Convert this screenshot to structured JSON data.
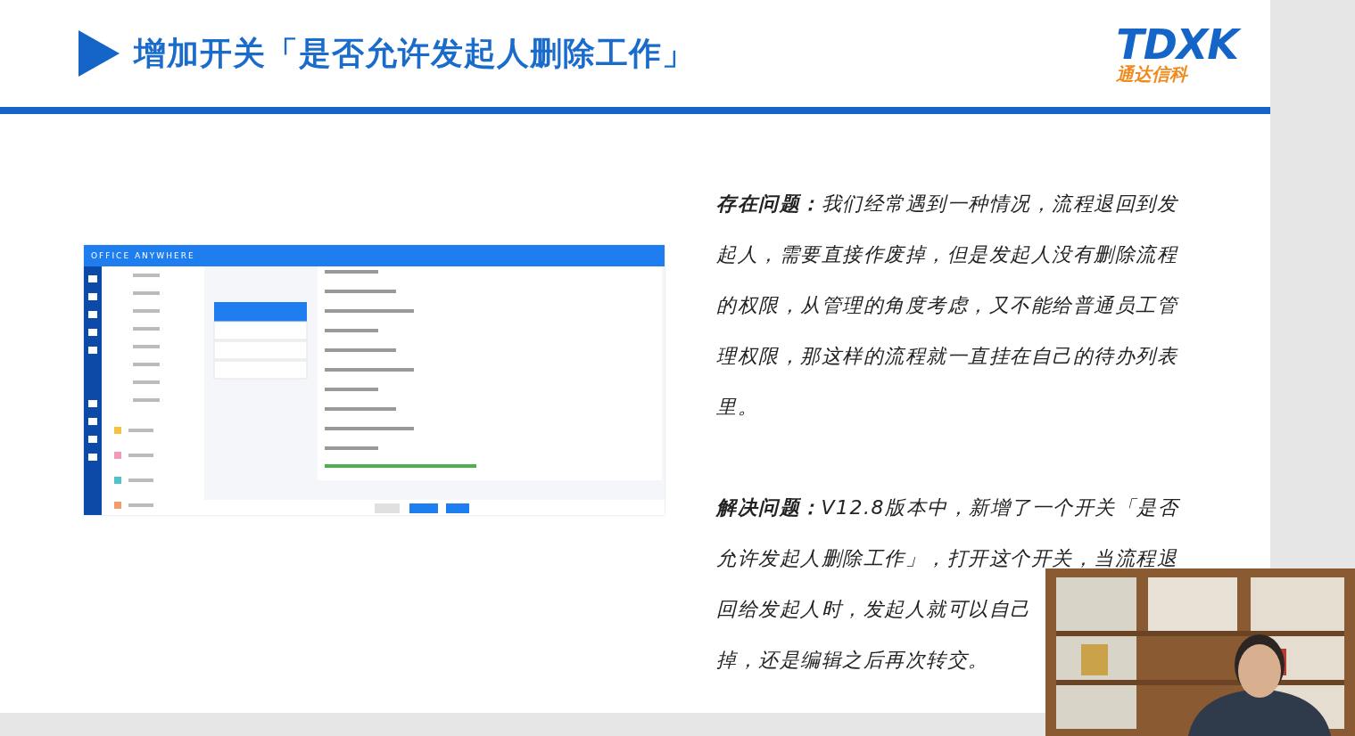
{
  "slide": {
    "title": "增加开关「是否允许发起人删除工作」",
    "logo": {
      "mark": "TDXK",
      "name": "通达信科"
    },
    "screenshot": {
      "kind": "app",
      "brand": "OFFICE ANYWHERE"
    },
    "paragraphs": [
      {
        "lines": [
          "**存在问题：**我们经常遇到一种情况，流程退回到发",
          "起人，需要直接作废掉，但是发起人没有删除流程",
          "的权限，从管理的角度考虑，又不能给普通员工管",
          "理权限，那这样的流程就一直挂在自己的待办列表",
          "里。"
        ]
      },
      {
        "lines": [
          "**解决问题：**V12.8版本中，新增了一个开关「是否",
          "允许发起人删除工作」，打开这个开关，当流程退",
          "回给发起人时，发起人就可以自己",
          "掉，还是编辑之后再次转交。"
        ]
      }
    ]
  }
}
